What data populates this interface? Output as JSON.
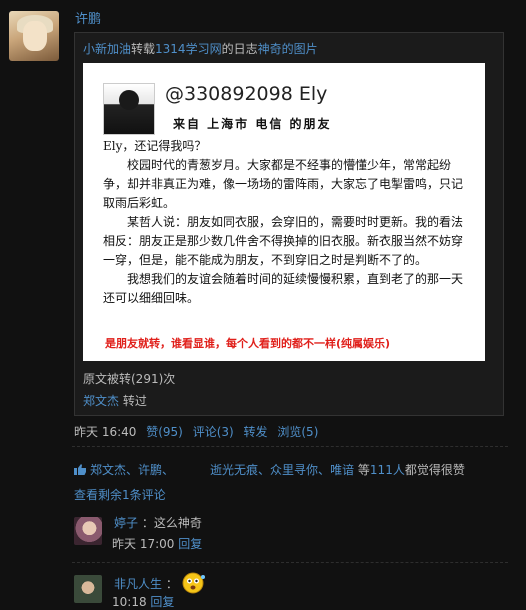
{
  "post": {
    "author": "许鹏",
    "repost": {
      "source_user": "小新加油",
      "action": "转载",
      "source_site": "1314学习网",
      "of": "的日志",
      "title": "神奇的图片",
      "card": {
        "handle": "@330892098 Ely",
        "from_line": "来自 上海市 电信 的朋友",
        "paragraphs": [
          "Ely，还记得我吗？",
          "　　校园时代的青葱岁月。大家都是不经事的懵懂少年，常常起纷争，却并非真正为难，像一场场的雷阵雨，大家忘了电掣雷鸣，只记取雨后彩虹。",
          "　　某哲人说：朋友如同衣服，会穿旧的，需要时时更新。我的看法相反：朋友正是那少数几件舍不得换掉的旧衣服。新衣服当然不妨穿一穿，但是，能不能成为朋友，不到穿旧之时是判断不了的。",
          "　　我想我们的友谊会随着时间的延续慢慢积累，直到老了的那一天还可以细细回味。"
        ],
        "footer": "是朋友就转，谁看显谁，每个人看到的都不一样(纯属娱乐)"
      },
      "count_text": "原文被转(291)次",
      "reposted_by": "郑文杰",
      "reposted_label": "转过"
    },
    "time": "昨天 16:40",
    "actions": {
      "like": "赞(95)",
      "comment": "评论(3)",
      "share": "转发",
      "views": "浏览(5)"
    },
    "likes": {
      "users": [
        "郑文杰、",
        "许鹏、",
        "",
        "逝光无痕、",
        "众里寻你、",
        "唯谙"
      ],
      "sep": "等",
      "count": "111人",
      "suffix": "都觉得很赞"
    },
    "more_comments": "查看剩余1条评论",
    "comments": [
      {
        "name": "婷子",
        "text": "：这么神奇",
        "time": "昨天 17:00",
        "reply": "回复"
      },
      {
        "name": "非凡人生",
        "text": "：",
        "time": "10:18",
        "reply": "回复"
      }
    ]
  },
  "colors": {
    "background": "#111111",
    "link": "#4f8fc9",
    "footer_red": "#e0201b"
  }
}
